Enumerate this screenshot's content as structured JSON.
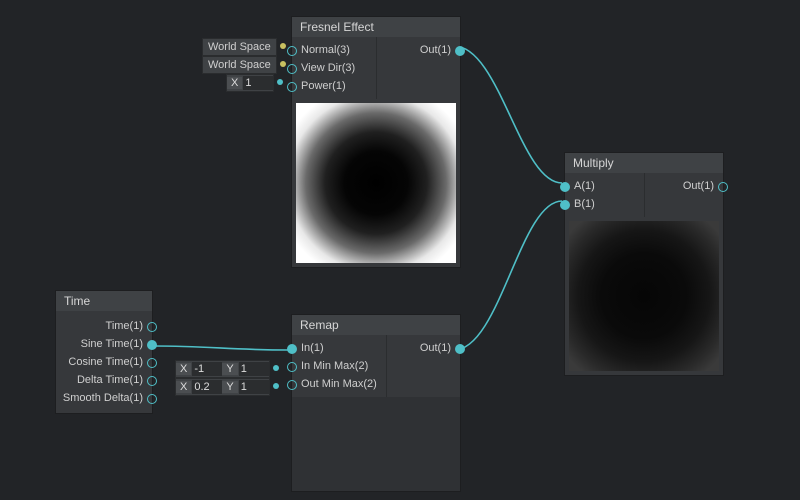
{
  "nodes": {
    "fresnel": {
      "title": "Fresnel Effect",
      "inputs": [
        "Normal(3)",
        "View Dir(3)",
        "Power(1)"
      ],
      "outputs": [
        "Out(1)"
      ],
      "inlets": [
        {
          "kind": "dropdown",
          "label": "World Space"
        },
        {
          "kind": "dropdown",
          "label": "World Space"
        },
        {
          "kind": "xfield",
          "x": "1"
        }
      ]
    },
    "time": {
      "title": "Time",
      "outputs": [
        "Time(1)",
        "Sine Time(1)",
        "Cosine Time(1)",
        "Delta Time(1)",
        "Smooth Delta(1)"
      ]
    },
    "remap": {
      "title": "Remap",
      "inputs": [
        "In(1)",
        "In Min Max(2)",
        "Out Min Max(2)"
      ],
      "outputs": [
        "Out(1)"
      ],
      "inlets": [
        null,
        {
          "kind": "xyfield",
          "x": "-1",
          "y": "1"
        },
        {
          "kind": "xyfield",
          "x": "0.2",
          "y": "1"
        }
      ]
    },
    "multiply": {
      "title": "Multiply",
      "inputs": [
        "A(1)",
        "B(1)"
      ],
      "outputs": [
        "Out(1)"
      ]
    }
  },
  "labels": {
    "X": "X",
    "Y": "Y"
  }
}
